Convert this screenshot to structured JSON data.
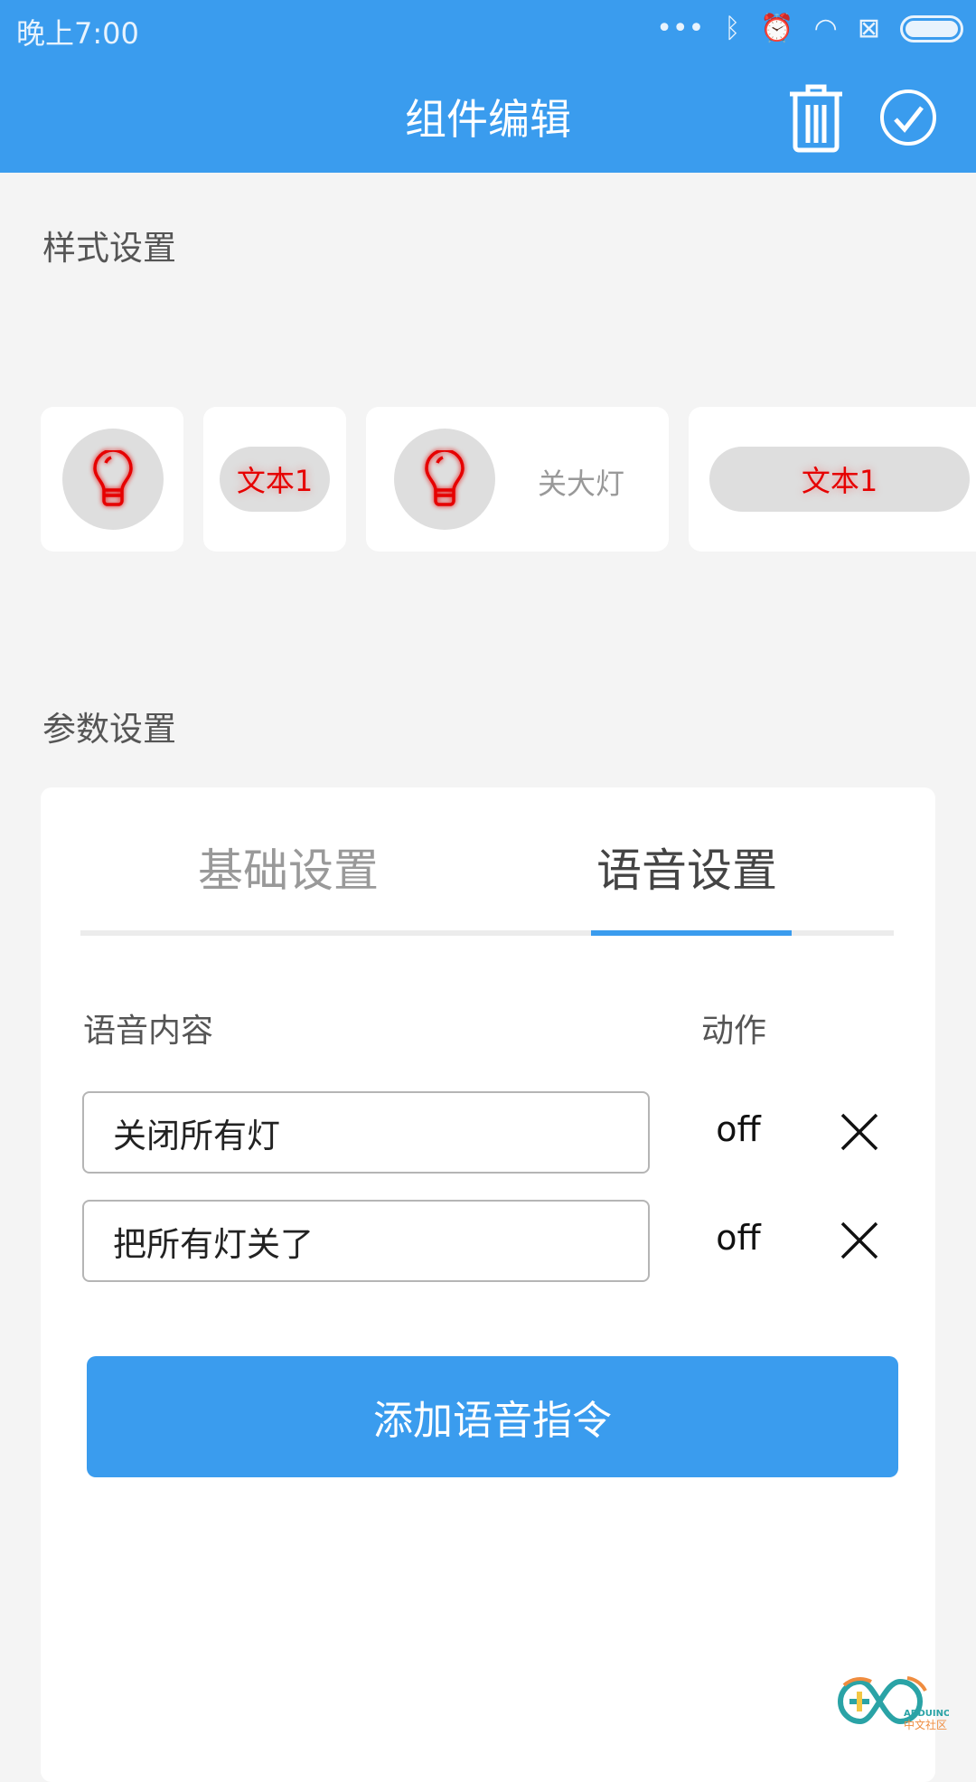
{
  "status_bar": {
    "time": "晚上7:00",
    "icons": [
      "more-dots-icon",
      "bluetooth-icon",
      "alarm-icon",
      "wifi-icon",
      "sim-disabled-icon",
      "battery-icon"
    ]
  },
  "app_bar": {
    "title": "组件编辑",
    "delete_icon": "trash-icon",
    "confirm_icon": "check-circle-icon"
  },
  "style_section": {
    "title": "样式设置",
    "options": [
      {
        "type": "icon",
        "icon": "lightbulb-icon"
      },
      {
        "type": "text",
        "label": "文本1"
      },
      {
        "type": "icon-text",
        "icon": "lightbulb-icon",
        "label": "关大灯"
      },
      {
        "type": "wide-text",
        "label": "文本1"
      }
    ]
  },
  "param_section": {
    "title": "参数设置",
    "tabs": [
      {
        "label": "基础设置",
        "active": false
      },
      {
        "label": "语音设置",
        "active": true
      }
    ],
    "columns": {
      "content": "语音内容",
      "action": "动作"
    },
    "commands": [
      {
        "text": "关闭所有灯",
        "action": "off"
      },
      {
        "text": "把所有灯关了",
        "action": "off"
      }
    ],
    "add_button": "添加语音指令"
  },
  "colors": {
    "primary": "#3a9cee",
    "accent_red": "#e60000"
  },
  "watermark": {
    "text": "ARDUINO 中文社区"
  }
}
